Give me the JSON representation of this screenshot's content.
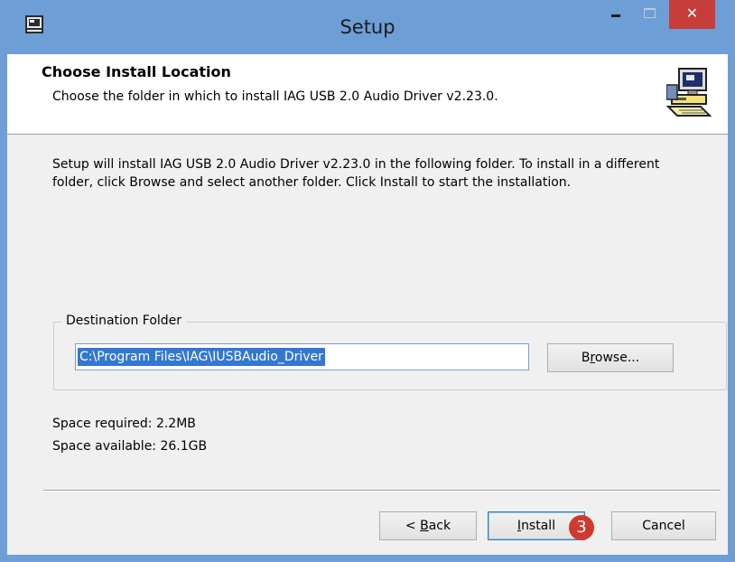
{
  "window": {
    "title": "Setup",
    "close_glyph": "✕"
  },
  "header": {
    "title": "Choose Install Location",
    "subtitle": "Choose the folder in which to install IAG USB 2.0 Audio Driver v2.23.0."
  },
  "body": {
    "description": "Setup will install IAG USB 2.0 Audio Driver v2.23.0 in the following folder. To install in a different folder, click Browse and select another folder. Click Install to start the installation."
  },
  "destination": {
    "group_label": "Destination Folder",
    "path_value": "C:\\Program Files\\IAG\\IUSBAudio_Driver",
    "browse_label_pre": "B",
    "browse_label_accel": "r",
    "browse_label_post": "owse..."
  },
  "space": {
    "required": "Space required: 2.2MB",
    "available": "Space available: 26.1GB"
  },
  "buttons": {
    "back_pre": "< ",
    "back_accel": "B",
    "back_post": "ack",
    "install_accel": "I",
    "install_post": "nstall",
    "cancel": "Cancel"
  },
  "annotation": {
    "step_number": "3",
    "color": "#d03a2e"
  },
  "colors": {
    "titlebar": "#6d9fd6",
    "close_button": "#c73d3a",
    "selection": "#3377d1",
    "dialog_bg": "#f0f0f0"
  },
  "icons": {
    "app": "setup-app-icon",
    "installer": "computer-installer-icon"
  }
}
